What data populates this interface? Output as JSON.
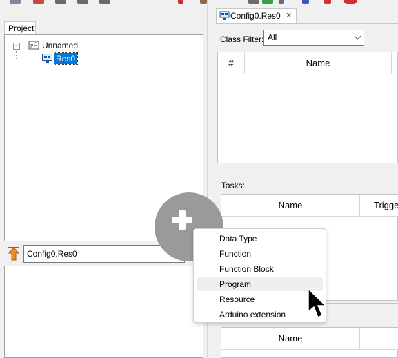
{
  "left_panel": {
    "project_tab": "Project",
    "tree": {
      "root": "Unnamed",
      "child": "Res0"
    },
    "library_combo_value": "Config0.Res0"
  },
  "editor": {
    "tab_label": "Config0.Res0",
    "tab_close": "✕",
    "class_filter_label": "Class Filter:",
    "class_filter_value": "All",
    "variables_grid": {
      "columns": [
        "#",
        "Name"
      ]
    },
    "tasks_label": "Tasks:",
    "tasks_grid": {
      "columns": [
        "Name",
        "Trigge"
      ]
    },
    "instances_grid": {
      "columns": [
        "Name"
      ]
    }
  },
  "add_menu": {
    "items": [
      "Data Type",
      "Function",
      "Function Block",
      "Program",
      "Resource",
      "Arduino extension"
    ],
    "highlighted": "Program"
  },
  "icons": {
    "plus": "plus-icon",
    "arrow": "mouse-pointer-icon",
    "library": "library-icon"
  },
  "colors": {
    "selection": "#0078d7",
    "add_circle": "#9a9a9a"
  }
}
